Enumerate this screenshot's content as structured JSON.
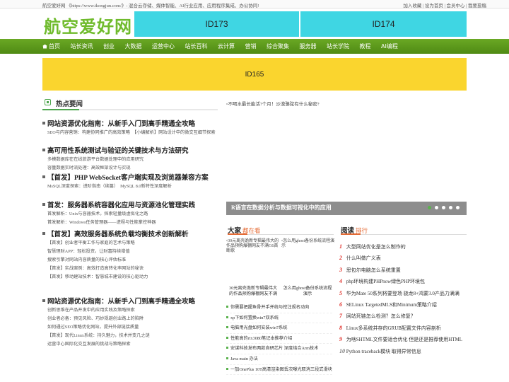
{
  "topbar": {
    "left": "航空爱好网 《https://www.tkongjun.com/》- 混合云存储、媒体智能、AI行业应用、应用程序集成、办公协同!",
    "right": "加入收藏 | 设为首页 | 会员中心 | 我要投稿"
  },
  "logo": "航空爱好网",
  "ads": {
    "top1": "ID173",
    "top2": "ID174",
    "banner": "ID165"
  },
  "nav": [
    "首页",
    "站长资讯",
    "创业",
    "大数据",
    "运营中心",
    "站长百科",
    "云计算",
    "营销",
    "综合聚集",
    "服务器",
    "站长学院",
    "教程",
    "AI编程"
  ],
  "hot": {
    "title": "热点要闻"
  },
  "articles": [
    {
      "title": "网站资源优化指南：从新手入门到高手精通全攻略",
      "subs": [
        "SEO与内容营销：构建协同推广的高效策略　【小编解析】网站设计中的微交互细节探索"
      ]
    },
    {
      "title": "高可用性系统测试与验证的关键技术与方法研究",
      "subs": [
        "多模数据库在在线旅游平台数据处理中的应用研究",
        "容量数据实时流处理：高效框架设计与实现"
      ]
    },
    {
      "title": "【首发】PHP WebSocket客户端实现及浏览器兼容方案",
      "subs": [
        "MsSQL深度探索：进阶指南（续篇）　MySQL 8.0新特性深度解析"
      ]
    },
    {
      "title": "首发：服务器系统容器化应用与资源池化管理实践",
      "subs": [
        "首发解析：Unix与容器技术，探索轻量级虚拟化之路",
        "首发解析：Windows任务管理器——进程与性能掌控神器"
      ]
    },
    {
      "title": "【首发】高效服务器系统负载均衡技术创新解析",
      "subs": [
        "【首发】创业者平衡工作与家庭的艺术与策略",
        "智慧理财APP：轻松投资，让财富持续增值",
        "搜索引擎对网站内容质量的核心评估标准",
        "【首发】实战案例：高效打造高转化率网站的秘诀",
        "【首发】移动建站技术：智慧城市建设的核心驱动力"
      ]
    },
    {
      "title": "网站资源优化指南：从新手入门到高手精通全攻略",
      "subs": [
        "创新思维在产品开发中的应用实践及策略探索",
        "创业者必备：预见风险、巧妙规避创业路上的陷阱",
        "如何通过SEO策略优化网站，提升外部链接质量",
        "【首发】现代Linux系统：持久魅力，技术并变几之谜",
        "运营中心国际化交互发展的挑战与策略探索"
      ]
    }
  ],
  "feature": {
    "image_alt": "不喝水最长能活?个月！沙漠骆驼有什么秘密?",
    "slide_title": "R语言在数据分析与数据可视化中的应用"
  },
  "popular": {
    "head_bold": "大家",
    "head_light": "都在看",
    "thumbs": [
      {
        "alt": "30元离壳诡新专辑最伟大的作品预购爆棚网友不满G6首断歌",
        "caption": "30元离壳诡新专辑最伟大的作品预购爆棚网友不满"
      },
      {
        "alt": "怎么用ghost备份系统流程演示",
        "caption": "怎么用ghost备份系统流程演示"
      }
    ],
    "list": [
      "你需要把握鱼骨并手并统与挖注规名动向",
      "xp下如何置换win7双系统",
      "电脑用光盘如何安装win7系统",
      "性能高的rtx3080笔记本推荐介绍",
      "安谋科技发布两款自研芯片 深度结合Arm技术",
      "Java main 办法",
      "一加OnePlus 10T高清渲染图丢次曝光取消三段式滑块"
    ]
  },
  "ranking": {
    "head_bold": "阅读",
    "head_light": "排行",
    "items": [
      {
        "n": "1",
        "t": "大型网站优化是怎么制作的"
      },
      {
        "n": "2",
        "t": "什么叫做广义表"
      },
      {
        "n": "3",
        "t": "思包尔电脑怎么系统重置"
      },
      {
        "n": "4",
        "t": "php环境构建PHPnow绿色PHP环境包"
      },
      {
        "n": "5",
        "t": "华为Mate 50系列将要登场 骁龙8+鸿蒙3.0产品力满满"
      },
      {
        "n": "6",
        "t": "SELinux TargetedMLS和Minimum策略介绍"
      },
      {
        "n": "7",
        "t": "网站死链怎么检测？怎么修复？"
      },
      {
        "n": "8",
        "t": "Linux多系统并存的GRUB配置文件内容剖析"
      },
      {
        "n": "9",
        "t": "为啥SHTML文件要适合优化 但是还是推荐使用HTML"
      },
      {
        "n": "10",
        "t": "Python traceback模块 取得异常信息"
      }
    ]
  },
  "colors": {
    "brand_green": "#6fbb2c",
    "nav_green": "#5a9a1a",
    "ad_cyan": "#3fd6e3",
    "ad_yellow": "#fad52e",
    "accent_orange": "#e46b35",
    "rank_red": "#e0322c"
  }
}
